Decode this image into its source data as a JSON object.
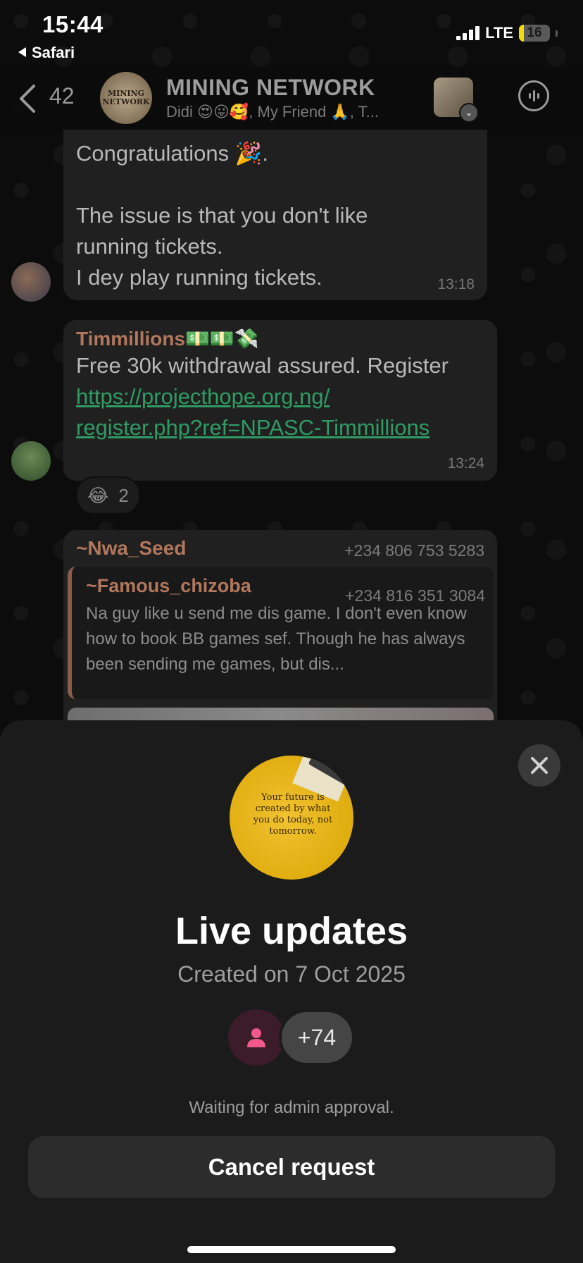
{
  "status_bar": {
    "time": "15:44",
    "back_app": "Safari",
    "network": "LTE",
    "battery_level": "16",
    "battery_fraction": 0.16
  },
  "header": {
    "back_count": "42",
    "group_name": "MINING NETWORK",
    "group_avatar_text": "MINING NETWORK",
    "members_preview": "Didi 😍😛🥰, My Friend 🙏, T..."
  },
  "messages": [
    {
      "lines": [
        "Congratulations 🎉.",
        "",
        "The issue is that you don't like",
        "running tickets.",
        "I dey play running tickets."
      ],
      "time": "13:18"
    },
    {
      "sender": "Timmillions💵💵💸",
      "text": "Free 30k withdrawal assured. Register",
      "link_line1": "https://projecthope.org.ng/",
      "link_line2": "register.php?ref=NPASC-Timmillions",
      "time": "13:24",
      "reaction_emoji": "😂",
      "reaction_count": "2"
    },
    {
      "sender": "~Nwa_Seed",
      "phone": "+234 806 753 5283",
      "quote_sender": "~Famous_chizoba",
      "quote_phone": "+234 816 351 3084",
      "quote_text": "Na guy like u send me dis game. I don't even know how to book BB games sef. Though he has always been sending me games, but dis..."
    }
  ],
  "sheet": {
    "image_text": "Your future is created by what you do today, not tomorrow.",
    "title": "Live updates",
    "created": "Created on 7 Oct 2025",
    "member_count": "+74",
    "status": "Waiting for admin approval.",
    "cancel_label": "Cancel request"
  },
  "colors": {
    "sender_name": "#b1775d",
    "link": "#2f9b63",
    "battery": "#f5d90a"
  }
}
